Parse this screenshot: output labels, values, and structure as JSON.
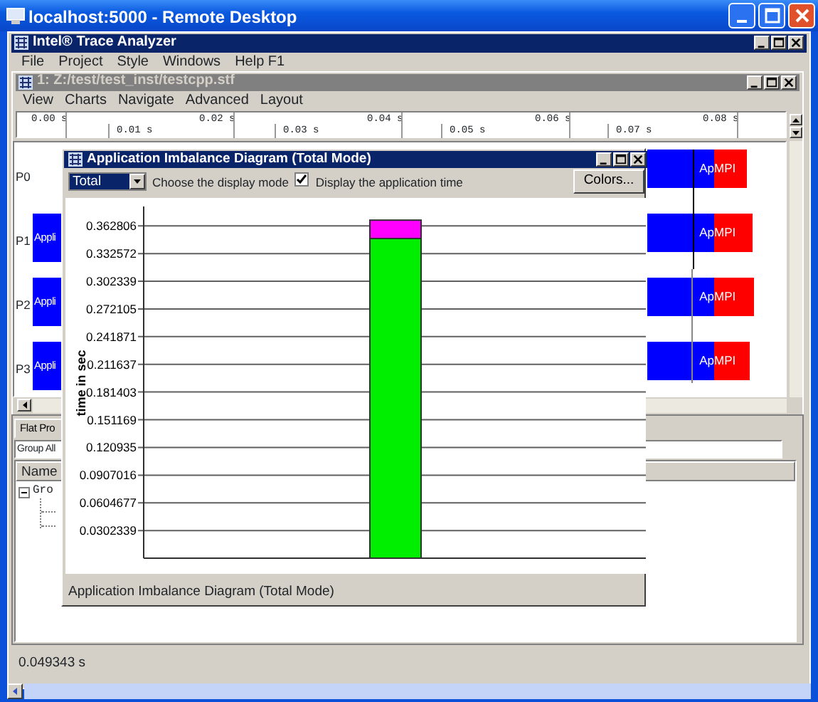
{
  "remote_window": {
    "title": "localhost:5000 - Remote Desktop"
  },
  "app": {
    "title": "Intel® Trace Analyzer",
    "menu": [
      "File",
      "Project",
      "Style",
      "Windows",
      "Help F1"
    ]
  },
  "document": {
    "title": "1: Z:/test/test_inst/testcpp.stf",
    "menu": [
      "View",
      "Charts",
      "Navigate",
      "Advanced",
      "Layout"
    ],
    "ruler_top": [
      "0.00 s",
      "0.02 s",
      "0.04 s",
      "0.06 s",
      "0.08 s"
    ],
    "ruler_bottom": [
      "0.01 s",
      "0.03 s",
      "0.05 s",
      "0.07 s"
    ],
    "processes": [
      {
        "label": "P0",
        "app_text": "Ap",
        "mpi_text": "MPI"
      },
      {
        "label": "P1",
        "left_text": "Appli",
        "app_text": "Ap",
        "mpi_text": "MPI"
      },
      {
        "label": "P2",
        "left_text": "Appli",
        "app_text": "Ap",
        "mpi_text": "MPI"
      },
      {
        "label": "P3",
        "left_text": "Appli",
        "app_text": "Ap",
        "mpi_text": "MPI"
      }
    ]
  },
  "lower_panel": {
    "tab": "Flat Pro",
    "group": "Group All",
    "column": "Name",
    "tree": [
      {
        "label": "Gro",
        "expanded": true
      }
    ]
  },
  "status": "0.049343 s",
  "dialog": {
    "title": "Application Imbalance Diagram (Total Mode)",
    "mode": "Total",
    "mode_label": "Choose the display mode",
    "show_app_time": {
      "label": "Display the application time",
      "checked": true
    },
    "colors_button": "Colors...",
    "chart_data": {
      "type": "bar",
      "ylabel": "time in sec",
      "stacked": true,
      "grid": true,
      "ylim": [
        0,
        0.384
      ],
      "yticks": [
        0.0302339,
        0.0604677,
        0.0907016,
        0.120935,
        0.151169,
        0.181403,
        0.211637,
        0.241871,
        0.272105,
        0.302339,
        0.332572,
        0.362806
      ],
      "series": [
        {
          "color": "#00ee00",
          "values": [
            0.349
          ]
        },
        {
          "color": "#ff00ff",
          "values": [
            0.02
          ]
        }
      ]
    },
    "footer": "Application Imbalance Diagram (Total Mode)"
  }
}
